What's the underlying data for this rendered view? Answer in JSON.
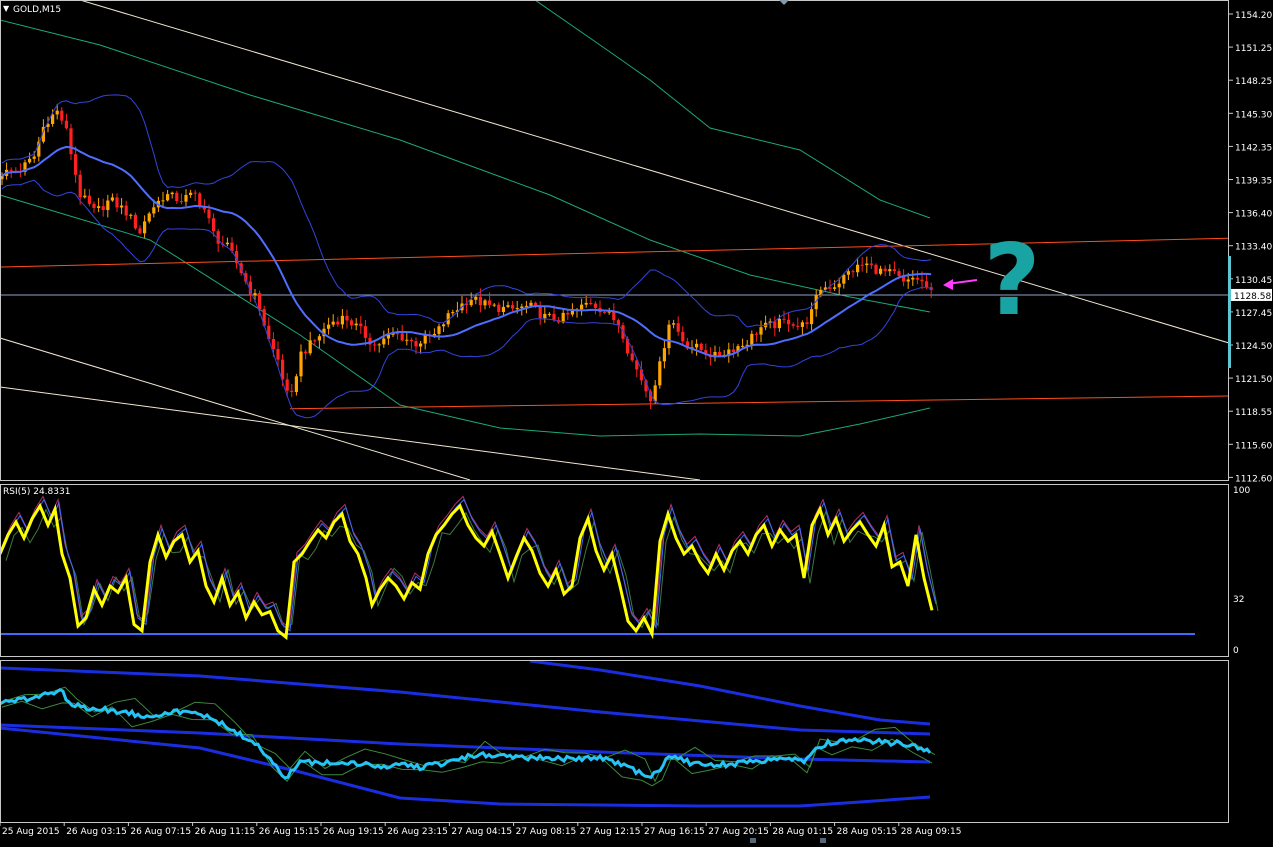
{
  "window": {
    "symbol_label": "GOLD,M15",
    "rsi_label": "RSI(5) 24.8331"
  },
  "colors": {
    "background": "#000000",
    "frame": "#c8c8c8",
    "bull_candle": "#ffa500",
    "bear_candle": "#ff2020",
    "bollinger": "#3344dd",
    "middle_band": "#4f6eff",
    "channel_green": "#1ca87a",
    "trend_white": "#f2e8d2",
    "horizontal_red": "#ff4d1a",
    "rsi_main": "#ffff00",
    "rsi_blue": "#3b6cff",
    "osc_cyan": "#26c4f5",
    "annotation": "#1aa3a3",
    "arrow": "#ff3cff"
  },
  "annotation": {
    "mark": "?"
  },
  "price_panel": {
    "y_ticks": [
      "1154.20",
      "1151.25",
      "1148.25",
      "1145.30",
      "1142.35",
      "1139.35",
      "1136.40",
      "1133.40",
      "1130.45",
      "1127.45",
      "1124.50",
      "1121.50",
      "1118.55",
      "1115.60",
      "1112.60"
    ],
    "current_price": "1128.58"
  },
  "rsi_panel": {
    "y_ticks": [
      "100",
      "32",
      "0"
    ]
  },
  "x_ticks": [
    "25 Aug 2015",
    "26 Aug 03:15",
    "26 Aug 07:15",
    "26 Aug 11:15",
    "26 Aug 15:15",
    "26 Aug 19:15",
    "26 Aug 23:15",
    "27 Aug 04:15",
    "27 Aug 08:15",
    "27 Aug 12:15",
    "27 Aug 16:15",
    "27 Aug 20:15",
    "28 Aug 01:15",
    "28 Aug 05:15",
    "28 Aug 09:15"
  ],
  "chart_data": [
    {
      "type": "candlestick",
      "symbol": "GOLD",
      "timeframe": "M15",
      "ylim": [
        1111.5,
        1155.5
      ],
      "x_ticks": [
        "25 Aug 2015",
        "26 Aug 03:15",
        "26 Aug 07:15",
        "26 Aug 11:15",
        "26 Aug 15:15",
        "26 Aug 19:15",
        "26 Aug 23:15",
        "27 Aug 04:15",
        "27 Aug 08:15",
        "27 Aug 12:15",
        "27 Aug 16:15",
        "27 Aug 20:15",
        "28 Aug 01:15",
        "28 Aug 05:15",
        "28 Aug 09:15"
      ],
      "close_path": [
        {
          "x": 0,
          "y": 1140.0
        },
        {
          "x": 20,
          "y": 1140.3
        },
        {
          "x": 34,
          "y": 1141.5
        },
        {
          "x": 45,
          "y": 1144.8
        },
        {
          "x": 57,
          "y": 1145.8
        },
        {
          "x": 65,
          "y": 1144.5
        },
        {
          "x": 72,
          "y": 1141.5
        },
        {
          "x": 80,
          "y": 1138.0
        },
        {
          "x": 95,
          "y": 1136.3
        },
        {
          "x": 110,
          "y": 1137.5
        },
        {
          "x": 125,
          "y": 1136.5
        },
        {
          "x": 140,
          "y": 1134.5
        },
        {
          "x": 150,
          "y": 1136.5
        },
        {
          "x": 165,
          "y": 1138.0
        },
        {
          "x": 180,
          "y": 1137.5
        },
        {
          "x": 195,
          "y": 1138.0
        },
        {
          "x": 205,
          "y": 1136.5
        },
        {
          "x": 215,
          "y": 1134.0
        },
        {
          "x": 228,
          "y": 1133.0
        },
        {
          "x": 240,
          "y": 1131.0
        },
        {
          "x": 250,
          "y": 1129.0
        },
        {
          "x": 258,
          "y": 1128.0
        },
        {
          "x": 268,
          "y": 1124.5
        },
        {
          "x": 278,
          "y": 1122.5
        },
        {
          "x": 290,
          "y": 1118.2
        },
        {
          "x": 300,
          "y": 1123.0
        },
        {
          "x": 315,
          "y": 1124.3
        },
        {
          "x": 330,
          "y": 1126.0
        },
        {
          "x": 345,
          "y": 1126.5
        },
        {
          "x": 360,
          "y": 1125.3
        },
        {
          "x": 375,
          "y": 1123.8
        },
        {
          "x": 395,
          "y": 1125.0
        },
        {
          "x": 415,
          "y": 1124.0
        },
        {
          "x": 435,
          "y": 1124.8
        },
        {
          "x": 450,
          "y": 1126.8
        },
        {
          "x": 470,
          "y": 1128.3
        },
        {
          "x": 490,
          "y": 1127.5
        },
        {
          "x": 510,
          "y": 1127.2
        },
        {
          "x": 530,
          "y": 1127.5
        },
        {
          "x": 545,
          "y": 1126.5
        },
        {
          "x": 560,
          "y": 1126.3
        },
        {
          "x": 575,
          "y": 1127.0
        },
        {
          "x": 590,
          "y": 1128.0
        },
        {
          "x": 605,
          "y": 1127.0
        },
        {
          "x": 620,
          "y": 1125.8
        },
        {
          "x": 630,
          "y": 1122.8
        },
        {
          "x": 640,
          "y": 1121.0
        },
        {
          "x": 650,
          "y": 1118.8
        },
        {
          "x": 660,
          "y": 1122.0
        },
        {
          "x": 670,
          "y": 1126.5
        },
        {
          "x": 685,
          "y": 1124.0
        },
        {
          "x": 700,
          "y": 1123.5
        },
        {
          "x": 715,
          "y": 1122.8
        },
        {
          "x": 730,
          "y": 1123.5
        },
        {
          "x": 745,
          "y": 1124.0
        },
        {
          "x": 760,
          "y": 1125.5
        },
        {
          "x": 775,
          "y": 1125.8
        },
        {
          "x": 790,
          "y": 1126.2
        },
        {
          "x": 800,
          "y": 1125.5
        },
        {
          "x": 810,
          "y": 1126.5
        },
        {
          "x": 820,
          "y": 1129.2
        },
        {
          "x": 835,
          "y": 1129.5
        },
        {
          "x": 850,
          "y": 1130.8
        },
        {
          "x": 865,
          "y": 1131.5
        },
        {
          "x": 880,
          "y": 1130.8
        },
        {
          "x": 895,
          "y": 1130.5
        },
        {
          "x": 905,
          "y": 1129.5
        },
        {
          "x": 915,
          "y": 1130.3
        },
        {
          "x": 925,
          "y": 1129.5
        },
        {
          "x": 932,
          "y": 1128.58
        }
      ],
      "horizontal_lines": [
        {
          "kind": "resistance",
          "price_at_start": 1131.2,
          "price_at_end": 1133.9
        },
        {
          "kind": "support",
          "price_at_start": 1117.9,
          "price_at_end": 1119.1
        },
        {
          "kind": "current",
          "price": 1128.58
        }
      ]
    },
    {
      "type": "line",
      "indicator": "RSI",
      "period": 5,
      "current_value": 24.8331,
      "ylim": [
        0,
        100
      ],
      "levels": [
        10
      ],
      "points": [
        {
          "x": 0,
          "y": 60
        },
        {
          "x": 8,
          "y": 72
        },
        {
          "x": 16,
          "y": 80
        },
        {
          "x": 24,
          "y": 70
        },
        {
          "x": 32,
          "y": 82
        },
        {
          "x": 40,
          "y": 90
        },
        {
          "x": 48,
          "y": 78
        },
        {
          "x": 55,
          "y": 88
        },
        {
          "x": 62,
          "y": 60
        },
        {
          "x": 70,
          "y": 45
        },
        {
          "x": 78,
          "y": 15
        },
        {
          "x": 86,
          "y": 20
        },
        {
          "x": 94,
          "y": 38
        },
        {
          "x": 102,
          "y": 28
        },
        {
          "x": 110,
          "y": 40
        },
        {
          "x": 118,
          "y": 36
        },
        {
          "x": 126,
          "y": 45
        },
        {
          "x": 134,
          "y": 16
        },
        {
          "x": 142,
          "y": 12
        },
        {
          "x": 150,
          "y": 55
        },
        {
          "x": 158,
          "y": 72
        },
        {
          "x": 166,
          "y": 58
        },
        {
          "x": 174,
          "y": 68
        },
        {
          "x": 182,
          "y": 72
        },
        {
          "x": 190,
          "y": 55
        },
        {
          "x": 198,
          "y": 62
        },
        {
          "x": 206,
          "y": 40
        },
        {
          "x": 214,
          "y": 30
        },
        {
          "x": 222,
          "y": 45
        },
        {
          "x": 230,
          "y": 28
        },
        {
          "x": 238,
          "y": 36
        },
        {
          "x": 246,
          "y": 20
        },
        {
          "x": 254,
          "y": 30
        },
        {
          "x": 262,
          "y": 22
        },
        {
          "x": 270,
          "y": 24
        },
        {
          "x": 278,
          "y": 12
        },
        {
          "x": 286,
          "y": 8
        },
        {
          "x": 294,
          "y": 55
        },
        {
          "x": 302,
          "y": 60
        },
        {
          "x": 310,
          "y": 68
        },
        {
          "x": 318,
          "y": 75
        },
        {
          "x": 326,
          "y": 70
        },
        {
          "x": 334,
          "y": 80
        },
        {
          "x": 342,
          "y": 85
        },
        {
          "x": 350,
          "y": 68
        },
        {
          "x": 358,
          "y": 60
        },
        {
          "x": 366,
          "y": 45
        },
        {
          "x": 372,
          "y": 28
        },
        {
          "x": 380,
          "y": 38
        },
        {
          "x": 388,
          "y": 45
        },
        {
          "x": 396,
          "y": 40
        },
        {
          "x": 404,
          "y": 32
        },
        {
          "x": 412,
          "y": 42
        },
        {
          "x": 420,
          "y": 38
        },
        {
          "x": 428,
          "y": 60
        },
        {
          "x": 436,
          "y": 72
        },
        {
          "x": 444,
          "y": 78
        },
        {
          "x": 452,
          "y": 85
        },
        {
          "x": 460,
          "y": 90
        },
        {
          "x": 468,
          "y": 78
        },
        {
          "x": 476,
          "y": 70
        },
        {
          "x": 484,
          "y": 65
        },
        {
          "x": 492,
          "y": 74
        },
        {
          "x": 500,
          "y": 60
        },
        {
          "x": 508,
          "y": 45
        },
        {
          "x": 516,
          "y": 58
        },
        {
          "x": 524,
          "y": 70
        },
        {
          "x": 532,
          "y": 62
        },
        {
          "x": 540,
          "y": 48
        },
        {
          "x": 548,
          "y": 40
        },
        {
          "x": 556,
          "y": 50
        },
        {
          "x": 564,
          "y": 35
        },
        {
          "x": 572,
          "y": 40
        },
        {
          "x": 580,
          "y": 70
        },
        {
          "x": 588,
          "y": 82
        },
        {
          "x": 596,
          "y": 62
        },
        {
          "x": 604,
          "y": 50
        },
        {
          "x": 612,
          "y": 60
        },
        {
          "x": 620,
          "y": 40
        },
        {
          "x": 628,
          "y": 18
        },
        {
          "x": 636,
          "y": 12
        },
        {
          "x": 644,
          "y": 20
        },
        {
          "x": 652,
          "y": 10
        },
        {
          "x": 660,
          "y": 68
        },
        {
          "x": 668,
          "y": 85
        },
        {
          "x": 676,
          "y": 70
        },
        {
          "x": 684,
          "y": 60
        },
        {
          "x": 692,
          "y": 65
        },
        {
          "x": 700,
          "y": 55
        },
        {
          "x": 708,
          "y": 48
        },
        {
          "x": 716,
          "y": 60
        },
        {
          "x": 724,
          "y": 50
        },
        {
          "x": 732,
          "y": 62
        },
        {
          "x": 740,
          "y": 68
        },
        {
          "x": 748,
          "y": 60
        },
        {
          "x": 756,
          "y": 72
        },
        {
          "x": 764,
          "y": 78
        },
        {
          "x": 772,
          "y": 65
        },
        {
          "x": 780,
          "y": 75
        },
        {
          "x": 788,
          "y": 68
        },
        {
          "x": 796,
          "y": 72
        },
        {
          "x": 804,
          "y": 45
        },
        {
          "x": 812,
          "y": 78
        },
        {
          "x": 820,
          "y": 88
        },
        {
          "x": 828,
          "y": 72
        },
        {
          "x": 836,
          "y": 82
        },
        {
          "x": 844,
          "y": 68
        },
        {
          "x": 852,
          "y": 75
        },
        {
          "x": 860,
          "y": 80
        },
        {
          "x": 868,
          "y": 72
        },
        {
          "x": 876,
          "y": 65
        },
        {
          "x": 884,
          "y": 78
        },
        {
          "x": 892,
          "y": 52
        },
        {
          "x": 900,
          "y": 55
        },
        {
          "x": 908,
          "y": 40
        },
        {
          "x": 916,
          "y": 72
        },
        {
          "x": 924,
          "y": 45
        },
        {
          "x": 932,
          "y": 24.8
        }
      ]
    },
    {
      "type": "line",
      "indicator": "oscillator",
      "points": [
        {
          "x": 0,
          "y": 76
        },
        {
          "x": 20,
          "y": 77
        },
        {
          "x": 40,
          "y": 80
        },
        {
          "x": 60,
          "y": 84
        },
        {
          "x": 72,
          "y": 74
        },
        {
          "x": 90,
          "y": 72
        },
        {
          "x": 110,
          "y": 71
        },
        {
          "x": 130,
          "y": 69
        },
        {
          "x": 150,
          "y": 67
        },
        {
          "x": 170,
          "y": 70
        },
        {
          "x": 190,
          "y": 69
        },
        {
          "x": 210,
          "y": 67
        },
        {
          "x": 230,
          "y": 58
        },
        {
          "x": 250,
          "y": 52
        },
        {
          "x": 270,
          "y": 40
        },
        {
          "x": 285,
          "y": 26
        },
        {
          "x": 300,
          "y": 38
        },
        {
          "x": 320,
          "y": 36
        },
        {
          "x": 340,
          "y": 38
        },
        {
          "x": 360,
          "y": 36
        },
        {
          "x": 380,
          "y": 34
        },
        {
          "x": 400,
          "y": 36
        },
        {
          "x": 420,
          "y": 34
        },
        {
          "x": 440,
          "y": 36
        },
        {
          "x": 460,
          "y": 40
        },
        {
          "x": 480,
          "y": 42
        },
        {
          "x": 500,
          "y": 41
        },
        {
          "x": 520,
          "y": 40
        },
        {
          "x": 540,
          "y": 41
        },
        {
          "x": 560,
          "y": 39
        },
        {
          "x": 580,
          "y": 40
        },
        {
          "x": 600,
          "y": 40
        },
        {
          "x": 620,
          "y": 36
        },
        {
          "x": 640,
          "y": 30
        },
        {
          "x": 650,
          "y": 27
        },
        {
          "x": 660,
          "y": 33
        },
        {
          "x": 670,
          "y": 42
        },
        {
          "x": 690,
          "y": 37
        },
        {
          "x": 710,
          "y": 35
        },
        {
          "x": 730,
          "y": 36
        },
        {
          "x": 750,
          "y": 37
        },
        {
          "x": 770,
          "y": 39
        },
        {
          "x": 790,
          "y": 40
        },
        {
          "x": 805,
          "y": 38
        },
        {
          "x": 815,
          "y": 46
        },
        {
          "x": 830,
          "y": 50
        },
        {
          "x": 850,
          "y": 52
        },
        {
          "x": 870,
          "y": 51
        },
        {
          "x": 890,
          "y": 50
        },
        {
          "x": 910,
          "y": 49
        },
        {
          "x": 930,
          "y": 45
        }
      ]
    }
  ]
}
